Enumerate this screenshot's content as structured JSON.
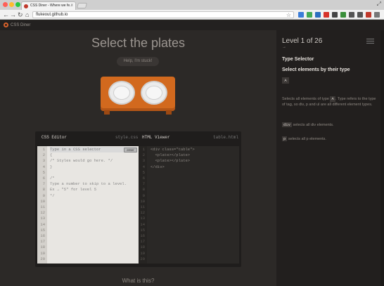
{
  "browser": {
    "tab_title": "CSS Diner - Where we fe...",
    "tab_close": "×",
    "url": "flukeout.github.io",
    "nav": {
      "back": "←",
      "forward": "→",
      "reload": "↻",
      "home": "⌂"
    },
    "star": "☆",
    "resize": "⤢",
    "colors": {
      "close": "#ff5f57",
      "minimize": "#febc2e",
      "zoom": "#28c840"
    },
    "extensions": [
      "#3b7dd8",
      "#44aa55",
      "#2c6fbf",
      "#d6332b",
      "#444444",
      "#3a8f3a",
      "#555555",
      "#555555",
      "#c0392b",
      "#777777"
    ]
  },
  "site": {
    "name": "CSS Diner"
  },
  "game": {
    "title": "Select the plates",
    "help_button": "Help, I'm stuck!",
    "what_is_this": "What is this?"
  },
  "css_editor": {
    "label": "CSS Editor",
    "filename": "style.css",
    "input_placeholder": "Type in a CSS selector",
    "enter_label": "enter",
    "lines": [
      "Type in a CSS selector",
      "{",
      "/* Styles would go here. */",
      "}",
      "",
      "/*",
      "Type a number to skip to a level.",
      "Ex → \"5\" for level 5",
      "*/"
    ],
    "line_numbers": [
      "1",
      "2",
      "3",
      "4",
      "5",
      "6",
      "7",
      "8",
      "9",
      "10",
      "11",
      "12",
      "13",
      "14",
      "15",
      "16",
      "17",
      "18",
      "19",
      "20"
    ]
  },
  "html_viewer": {
    "label": "HTML Viewer",
    "filename": "table.html",
    "lines": [
      "<div class=\"table\">",
      "  <plate></plate>",
      "  <plate></plate>",
      "</div>"
    ],
    "line_numbers": [
      "1",
      "2",
      "3",
      "4",
      "5",
      "6",
      "7",
      "8",
      "9",
      "10",
      "11",
      "12",
      "13",
      "14",
      "15",
      "16",
      "17",
      "18",
      "19",
      "20"
    ]
  },
  "sidebar": {
    "level": "Level 1 of 26",
    "arrow": "→",
    "selector_name": "Type Selector",
    "title": "Select elements by their type",
    "syntax": "A",
    "description_pre": "Selects all elements of type",
    "description_chip": "A",
    "description_post": ". Type refers to the type of tag, so div, p and ul are all different element types.",
    "examples": [
      {
        "code": "div",
        "text": "selects all div elements."
      },
      {
        "code": "p",
        "text": "selects all p elements."
      }
    ]
  }
}
